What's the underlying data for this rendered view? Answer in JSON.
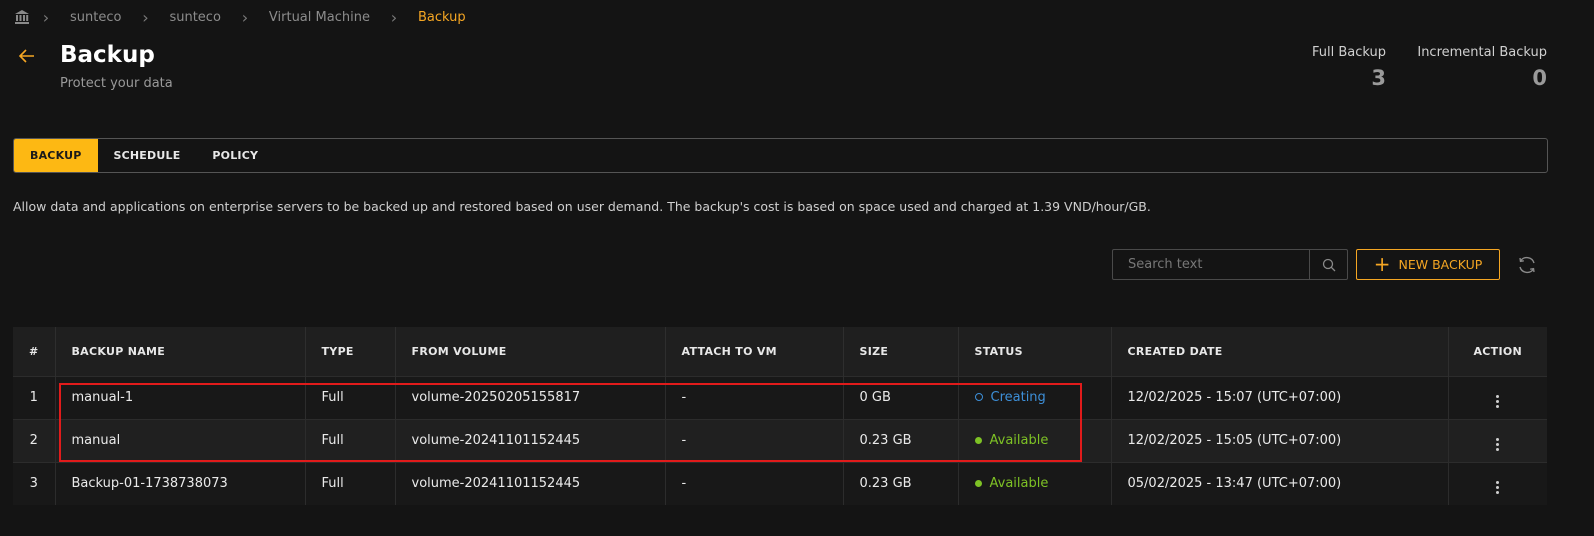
{
  "breadcrumb": {
    "home_icon": "bank-icon",
    "items": [
      "sunteco",
      "sunteco",
      "Virtual Machine",
      "Backup"
    ]
  },
  "header": {
    "title": "Backup",
    "subtitle": "Protect your data",
    "stats": [
      {
        "label": "Full Backup",
        "value": "3"
      },
      {
        "label": "Incremental Backup",
        "value": "0"
      }
    ]
  },
  "tabs": [
    {
      "label": "BACKUP",
      "active": true
    },
    {
      "label": "SCHEDULE",
      "active": false
    },
    {
      "label": "POLICY",
      "active": false
    }
  ],
  "description": "Allow data and applications on enterprise servers to be backed up and restored based on user demand. The backup's cost is based on space used and charged at 1.39 VND/hour/GB.",
  "toolbar": {
    "search_placeholder": "Search text",
    "new_backup_label": "NEW BACKUP"
  },
  "table": {
    "columns": [
      "#",
      "BACKUP NAME",
      "TYPE",
      "FROM VOLUME",
      "ATTACH TO VM",
      "SIZE",
      "STATUS",
      "CREATED DATE",
      "ACTION"
    ],
    "rows": [
      {
        "index": "1",
        "name": "manual-1",
        "type": "Full",
        "volume": "volume-20250205155817",
        "vm": "-",
        "size": "0 GB",
        "status": "Creating",
        "created": "12/02/2025 - 15:07 (UTC+07:00)"
      },
      {
        "index": "2",
        "name": "manual",
        "type": "Full",
        "volume": "volume-20241101152445",
        "vm": "-",
        "size": "0.23 GB",
        "status": "Available",
        "created": "12/02/2025 - 15:05 (UTC+07:00)"
      },
      {
        "index": "3",
        "name": "Backup-01-1738738073",
        "type": "Full",
        "volume": "volume-20241101152445",
        "vm": "-",
        "size": "0.23 GB",
        "status": "Available",
        "created": "05/02/2025 - 13:47 (UTC+07:00)"
      }
    ]
  },
  "colors": {
    "accent": "#f5a623",
    "available": "#7ec225",
    "creating": "#3d8fd8",
    "highlight": "#e11b1b"
  }
}
